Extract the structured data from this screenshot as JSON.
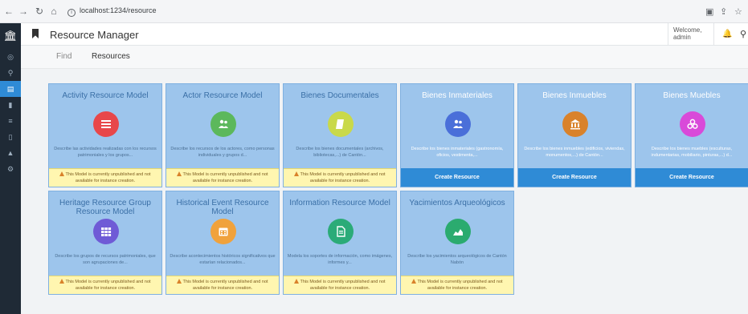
{
  "browser": {
    "url": "localhost:1234/resource"
  },
  "header": {
    "title": "Resource Manager",
    "welcome_line1": "Welcome,",
    "welcome_line2": "admin"
  },
  "tabs": [
    {
      "label": "Find"
    },
    {
      "label": "Resources"
    }
  ],
  "cards": [
    {
      "title": "Activity Resource Model",
      "description": "Describe las actividades realizadas con los recursos patrimoniales y los grupos...",
      "warning": "This Model is currently unpublished and not available for instance creation.",
      "icon_color": "#e8474a",
      "icon": "list-icon"
    },
    {
      "title": "Actor Resource Model",
      "description": "Describe los recursos de los actores, como personas individuales y grupos d...",
      "warning": "This Model is currently unpublished and not available for instance creation.",
      "icon_color": "#5cb85c",
      "icon": "users-icon"
    },
    {
      "title": "Bienes Documentales",
      "description": "Describe los bienes documentales (archivos, bibliotecas,...) de Cantón...",
      "warning": "This Model is currently unpublished and not available for instance creation.",
      "icon_color": "#c9d94a",
      "icon": "document-icon"
    },
    {
      "title": "Bienes Inmateriales",
      "description": "Describe los bienes inmateriales (gastronomía, oficios, vestimenta,...",
      "button": "Create Resource",
      "icon_color": "#4a6fd9",
      "icon": "users-icon"
    },
    {
      "title": "Bienes Inmuebles",
      "description": "Describe los bienes inmuebles (edificios, viviendas, monumentos,...) de Cantón...",
      "button": "Create Resource",
      "icon_color": "#d9822b",
      "icon": "bank-icon"
    },
    {
      "title": "Bienes Muebles",
      "description": "Describe los bienes muebles (esculturas, indumentarias, mobiliario, pinturas,...) d...",
      "button": "Create Resource",
      "icon_color": "#d94ad9",
      "icon": "cubes-icon"
    },
    {
      "title": "Heritage Resource Group Resource Model",
      "description": "Describe los grupos de recursos patrimoniales, que son agrupaciones de...",
      "warning": "This Model is currently unpublished and not available for instance creation.",
      "icon_color": "#6f5bd6",
      "icon": "grid-icon"
    },
    {
      "title": "Historical Event Resource Model",
      "description": "Describe acontecimientos históricos significativos que estarían relacionados...",
      "warning": "This Model is currently unpublished and not available for instance creation.",
      "icon_color": "#f0a23c",
      "icon": "calendar-icon"
    },
    {
      "title": "Information Resource Model",
      "description": "Modela los soportes de información, como imágenes, informes y...",
      "warning": "This Model is currently unpublished and not available for instance creation.",
      "icon_color": "#2bab78",
      "icon": "file-icon"
    },
    {
      "title": "Yacimientos Arqueológicos",
      "description": "Describe los yacimientos arqueológicos de Cantón Nabón",
      "warning": "This Model is currently unpublished and not available for instance creation.",
      "icon_color": "#2bab6f",
      "icon": "area-chart-icon"
    }
  ]
}
